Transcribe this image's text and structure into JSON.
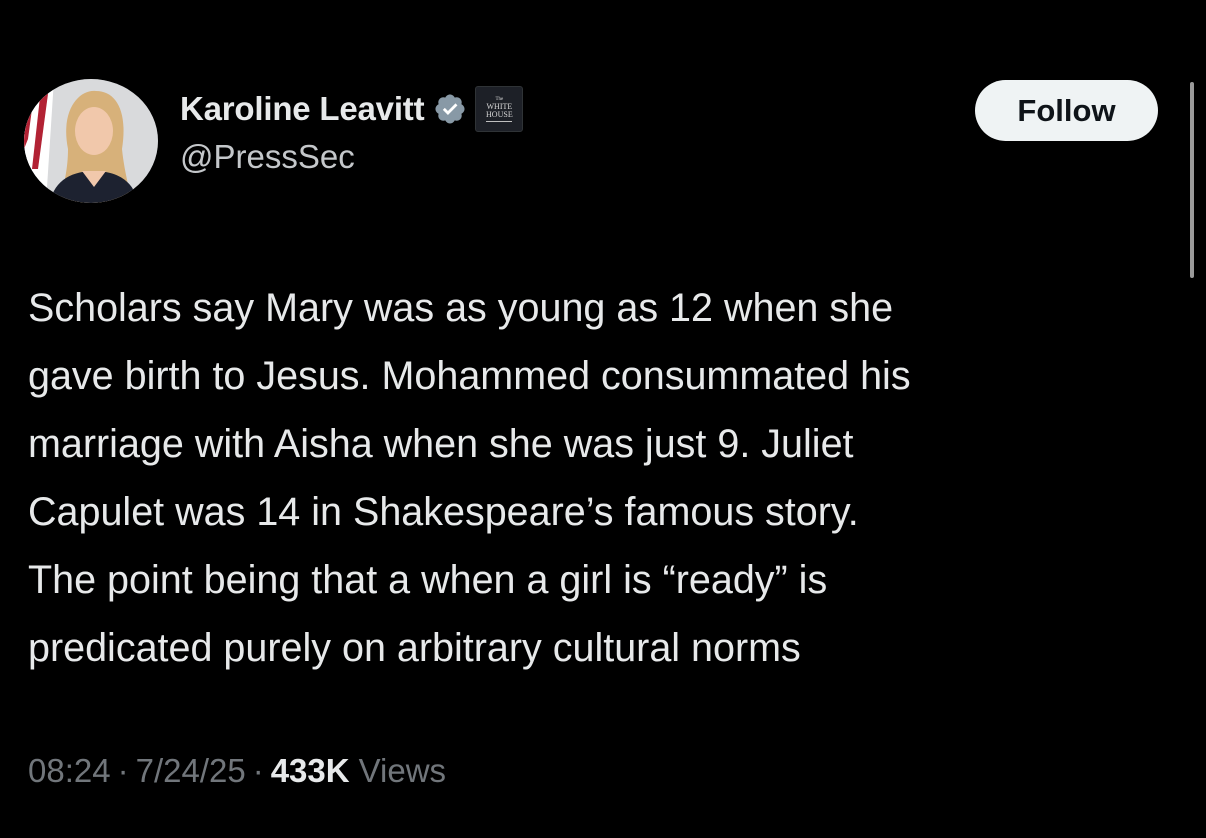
{
  "tweet": {
    "author": {
      "display_name": "Karoline Leavitt",
      "handle": "@PressSec",
      "verified_icon": "verified-badge-icon",
      "affiliation_badge": {
        "line1": "The",
        "line2": "WHITE",
        "line3": "HOUSE"
      }
    },
    "follow_label": "Follow",
    "text_lines": [
      "Scholars say Mary was as young as 12 when she",
      "gave birth to Jesus. Mohammed consummated his",
      "marriage with Aisha when she was just 9. Juliet",
      "Capulet was 14 in Shakespeare’s famous story.",
      "The point being that a when a girl is “ready” is",
      "predicated purely on arbitrary cultural norms"
    ],
    "time": "08:24",
    "date": "7/24/25",
    "separator": "·",
    "views_count": "433K",
    "views_label": "Views"
  },
  "colors": {
    "background": "#000000",
    "text_primary": "#e7e9ea",
    "text_secondary": "#71767b",
    "verified_fill": "#8899a6",
    "follow_button_bg": "#eff3f4"
  }
}
